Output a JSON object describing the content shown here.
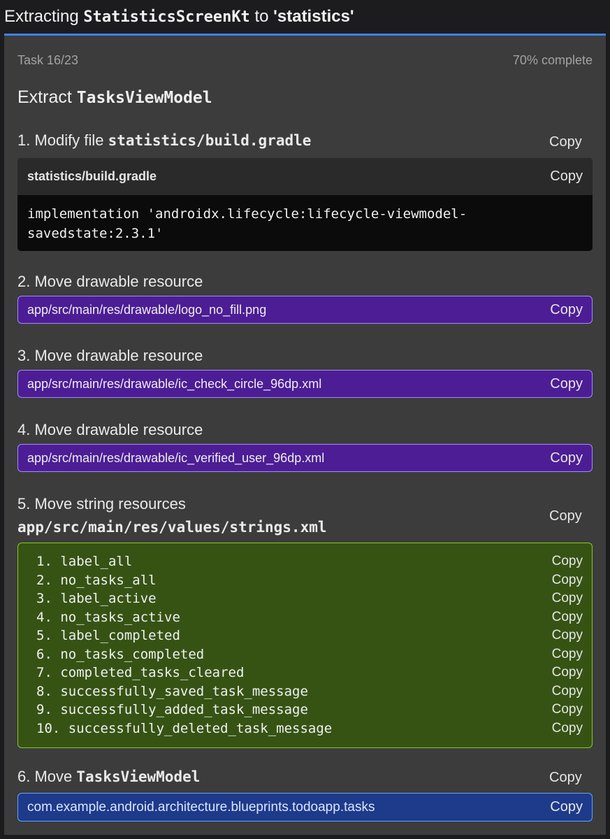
{
  "title": {
    "prefix": "Extracting",
    "class_name": "StatisticsScreenKt",
    "middle": "to",
    "module": "'statistics'"
  },
  "task": {
    "counter": "Task 16/23",
    "progress": "70% complete",
    "title_prefix": "Extract",
    "title_name": "TasksViewModel"
  },
  "copy_label": "Copy",
  "steps": [
    {
      "label": "1. Modify file",
      "name": "statistics/build.gradle",
      "file": "statistics/build.gradle",
      "code": "implementation 'androidx.lifecycle:lifecycle-viewmodel-\nsavedstate:2.3.1'"
    },
    {
      "label": "2. Move drawable resource",
      "path": "app/src/main/res/drawable/logo_no_fill.png"
    },
    {
      "label": "3. Move drawable resource",
      "path": "app/src/main/res/drawable/ic_check_circle_96dp.xml"
    },
    {
      "label": "4. Move drawable resource",
      "path": "app/src/main/res/drawable/ic_verified_user_96dp.xml"
    },
    {
      "label": "5. Move string resources",
      "name": "app/src/main/res/values/strings.xml",
      "strings": [
        "1. label_all",
        "2. no_tasks_all",
        "3. label_active",
        "4. no_tasks_active",
        "5. label_completed",
        "6. no_tasks_completed",
        "7. completed_tasks_cleared",
        "8. successfully_saved_task_message",
        "9. successfully_added_task_message",
        "10. successfully_deleted_task_message"
      ]
    },
    {
      "label": "6. Move",
      "name": "TasksViewModel",
      "package": "com.example.android.architecture.blueprints.todoapp.tasks"
    }
  ],
  "colors": {
    "accent": "#3b82f6",
    "drawable_box": "#4c1d95",
    "strings_box": "#365314",
    "package_box": "#1e3a8a"
  }
}
